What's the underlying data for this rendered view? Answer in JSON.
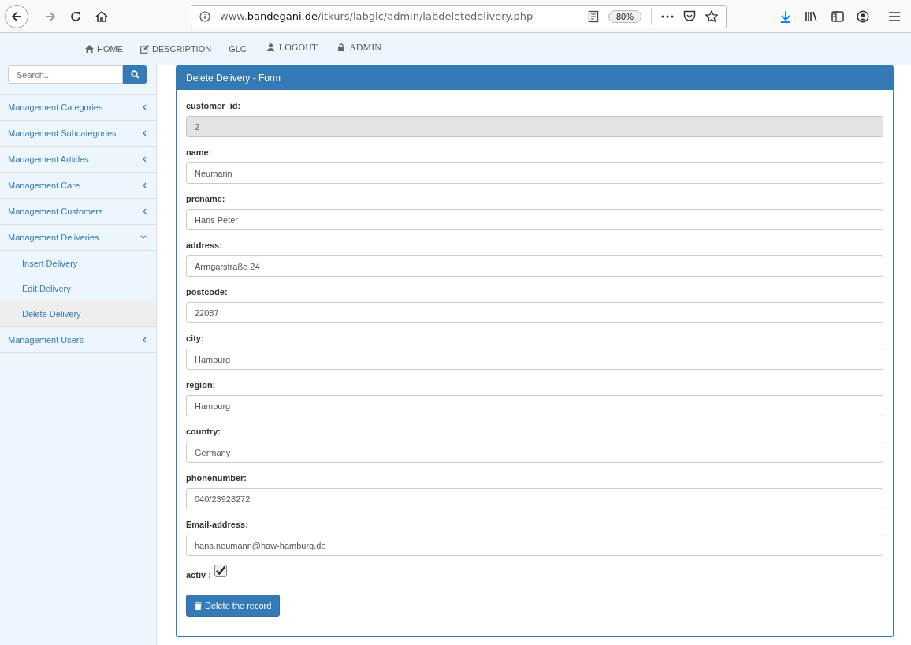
{
  "browser": {
    "url": "www.**bandegani.de**/itkurs/labglc/admin/labdeletedelivery.php",
    "zoom": "80%"
  },
  "nav": [
    {
      "label": "HOME"
    },
    {
      "label": "DESCRIPTION"
    },
    {
      "label": "GLC"
    },
    {
      "label": "LOGOUT"
    },
    {
      "label": "ADMIN"
    }
  ],
  "sidebar": {
    "search": {
      "placeholder": "Search..."
    },
    "items": [
      {
        "label": "Management Categories",
        "expanded": false
      },
      {
        "label": "Management Subcategories",
        "expanded": false
      },
      {
        "label": "Management Articles",
        "expanded": false
      },
      {
        "label": "Management Care",
        "expanded": false
      },
      {
        "label": "Management Customers",
        "expanded": false
      },
      {
        "label": "Management Deliveries",
        "expanded": true,
        "children": [
          {
            "label": "Insert Delivery",
            "selected": false
          },
          {
            "label": "Edit Delivery",
            "selected": false
          },
          {
            "label": "Delete Delivery",
            "selected": true
          }
        ]
      },
      {
        "label": "Management Users",
        "expanded": false
      }
    ]
  },
  "form": {
    "title": "Delete Delivery - Form",
    "fields": [
      {
        "label": "customer_id:",
        "value": "2",
        "disabled": true
      },
      {
        "label": "name:",
        "value": "Neumann",
        "disabled": false
      },
      {
        "label": "prename:",
        "value": "Hans Peter",
        "disabled": false
      },
      {
        "label": "address:",
        "value": "Armgarstraße 24",
        "disabled": false
      },
      {
        "label": "postcode:",
        "value": "22087",
        "disabled": false
      },
      {
        "label": "city:",
        "value": "Hamburg",
        "disabled": false
      },
      {
        "label": "region:",
        "value": "Hamburg",
        "disabled": false
      },
      {
        "label": "country:",
        "value": "Germany",
        "disabled": false
      },
      {
        "label": "phonenumber:",
        "value": "040/23928272",
        "disabled": false
      },
      {
        "label": "Email-address:",
        "value": "hans.neumann@haw-hamburg.de",
        "disabled": false
      }
    ],
    "activ": {
      "label": "activ :",
      "checked": true
    },
    "button": "Delete the record"
  }
}
